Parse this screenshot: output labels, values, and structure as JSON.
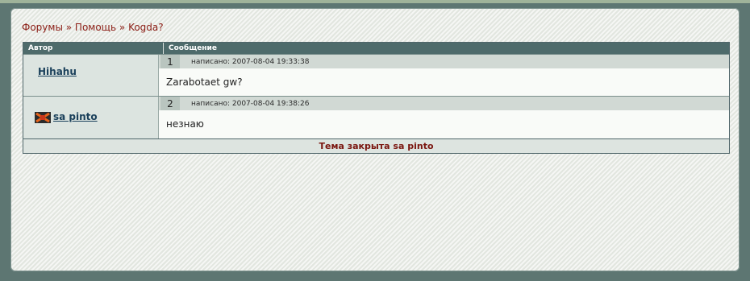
{
  "breadcrumb": {
    "forums": "Форумы",
    "sep1": "»",
    "help": "Помощь",
    "sep2": "»",
    "topic": "Kogda?"
  },
  "table": {
    "col_author": "Автор",
    "col_message": "Сообщение"
  },
  "posts": [
    {
      "author": "Hihahu",
      "number": "1",
      "date": "написано: 2007-08-04 19:33:38",
      "text": "Zarabotaet gw?"
    },
    {
      "author": "sa pinto",
      "number": "2",
      "date": "написано: 2007-08-04 19:38:26",
      "text": "незнаю"
    }
  ],
  "footer": {
    "closed_text": "Тема закрыта sa pinto"
  },
  "colors": {
    "breadcrumb": "#8b1c14",
    "header": "#4e6b6b",
    "footer_text": "#7a150f",
    "author_link": "#193f5a"
  }
}
